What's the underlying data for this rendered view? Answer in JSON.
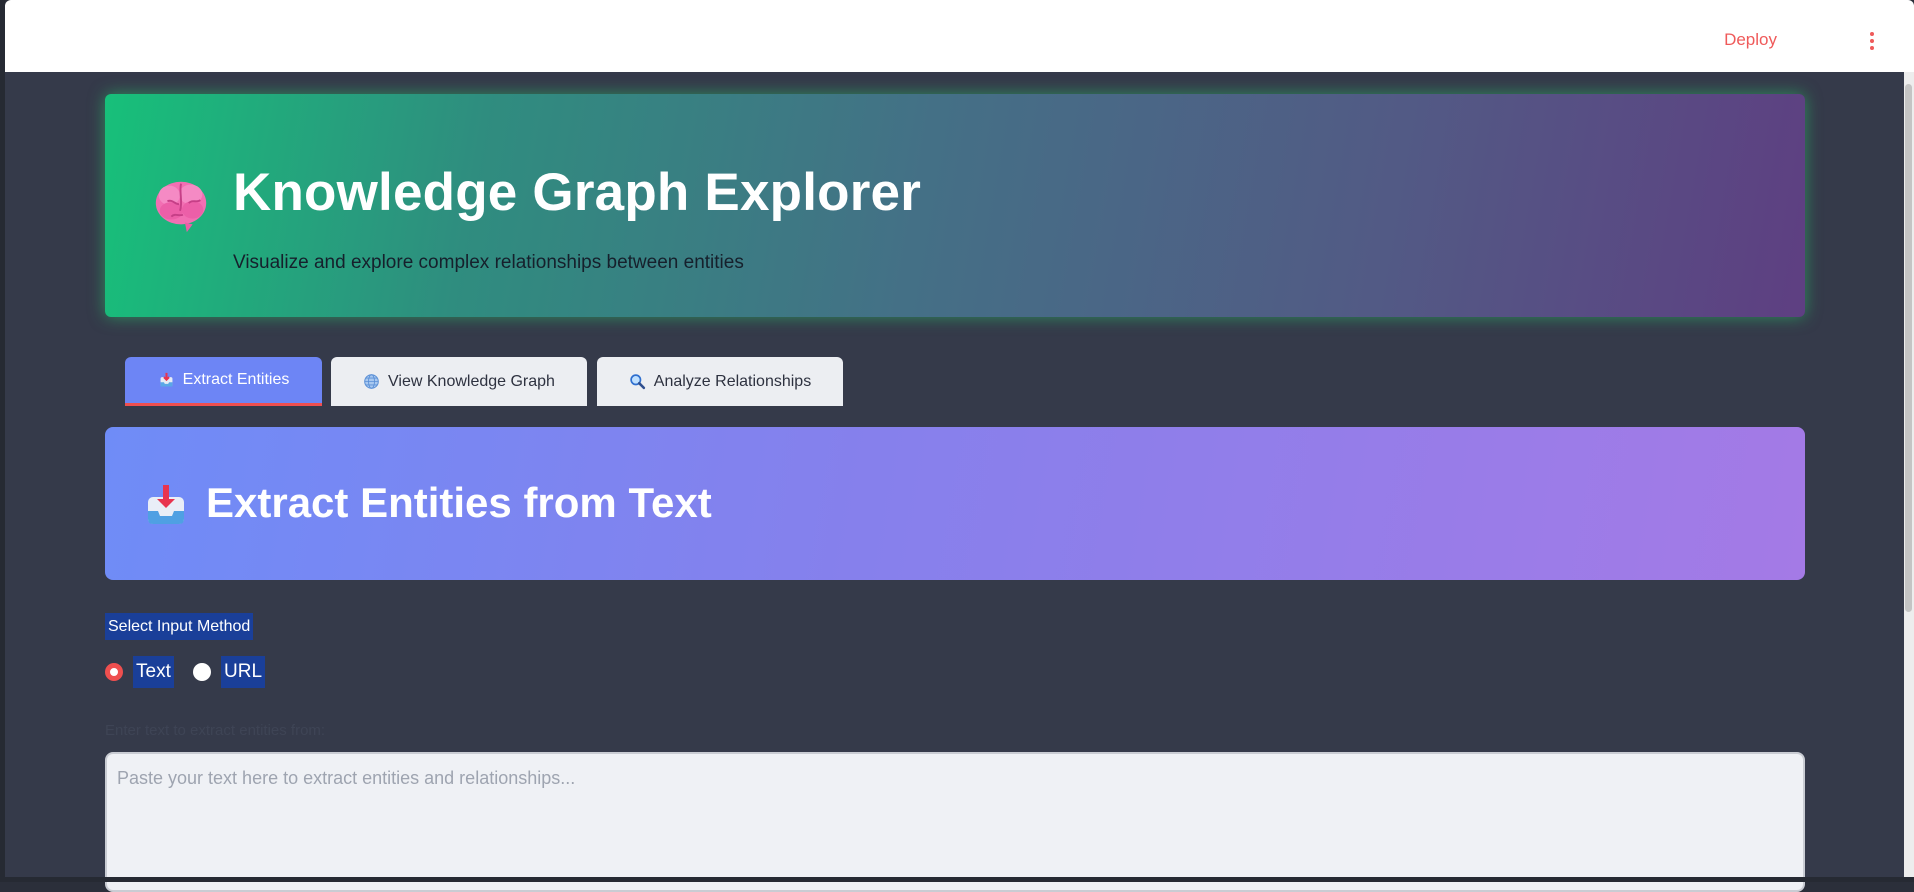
{
  "topbar": {
    "deploy_label": "Deploy",
    "menu_icon": "kebab-menu-icon"
  },
  "header": {
    "icon": "brain-icon",
    "title": "Knowledge Graph Explorer",
    "subtitle": "Visualize and explore complex relationships between entities"
  },
  "tabs": [
    {
      "label": "Extract Entities",
      "icon": "inbox-tray-icon",
      "active": true
    },
    {
      "label": "View Knowledge Graph",
      "icon": "globe-icon",
      "active": false
    },
    {
      "label": "Analyze Relationships",
      "icon": "magnifier-icon",
      "active": false
    }
  ],
  "section": {
    "icon": "inbox-tray-icon",
    "title": "Extract Entities from Text"
  },
  "input_method": {
    "label": "Select Input Method",
    "options": [
      {
        "label": "Text",
        "selected": true
      },
      {
        "label": "URL",
        "selected": false
      }
    ]
  },
  "text_input": {
    "label": "Enter text to extract entities from:",
    "placeholder": "Paste your text here to extract entities and relationships..."
  },
  "colors": {
    "accent": "#ef4f4f",
    "tab_active": "#6d85f5",
    "page_background": "#353a4a",
    "selection_highlight": "#1a3f99"
  }
}
